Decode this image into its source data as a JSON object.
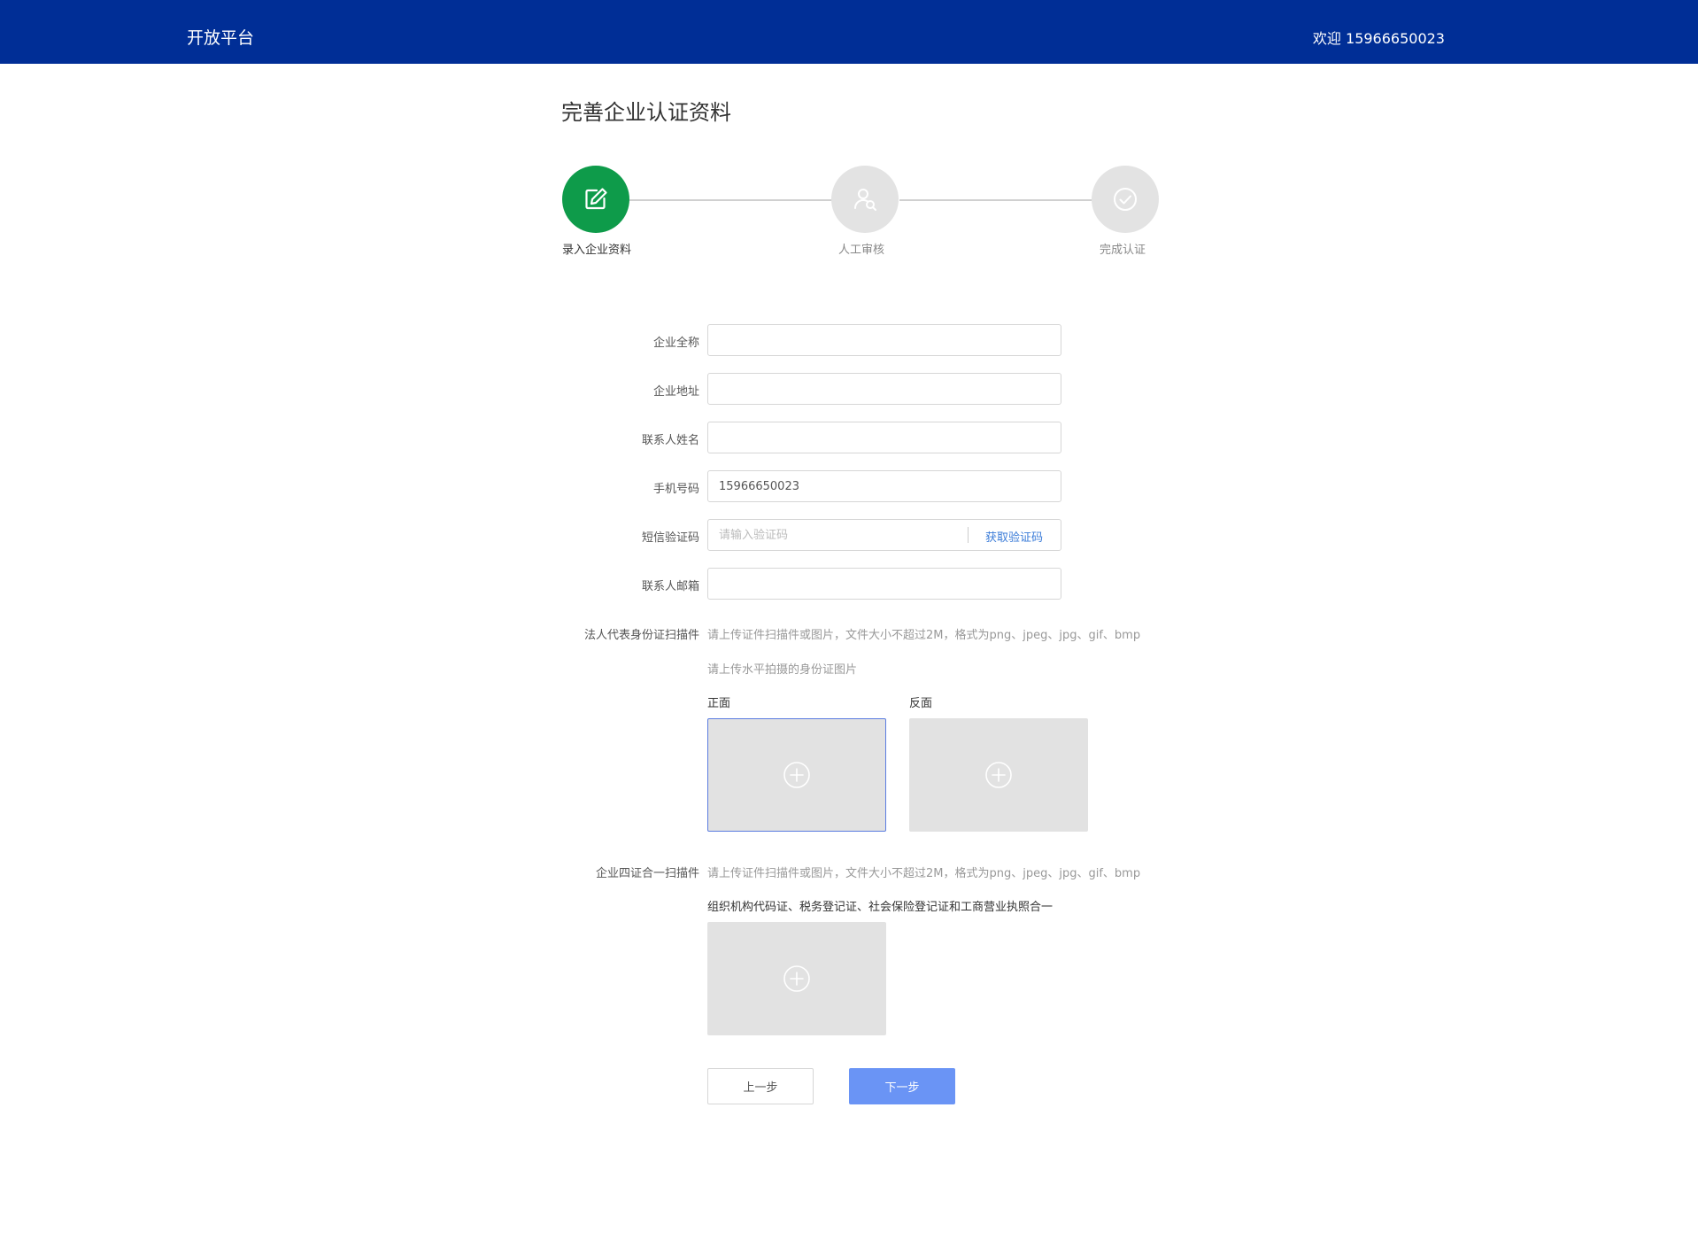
{
  "header": {
    "brand": "开放平台",
    "welcome": "欢迎 15966650023"
  },
  "page_title": "完善企业认证资料",
  "steps": [
    {
      "label": "录入企业资料",
      "icon": "edit-icon",
      "active": true
    },
    {
      "label": "人工审核",
      "icon": "review-icon",
      "active": false
    },
    {
      "label": "完成认证",
      "icon": "check-icon",
      "active": false
    }
  ],
  "form": {
    "company_name_label": "企业全称",
    "company_name_value": "",
    "company_address_label": "企业地址",
    "company_address_value": "",
    "contact_name_label": "联系人姓名",
    "contact_name_value": "",
    "phone_label": "手机号码",
    "phone_value": "15966650023",
    "sms_code_label": "短信验证码",
    "sms_code_placeholder": "请输入验证码",
    "get_code_label": "获取验证码",
    "email_label": "联系人邮箱",
    "email_value": ""
  },
  "id_card": {
    "label": "法人代表身份证扫描件",
    "hint": "请上传证件扫描件或图片，文件大小不超过2M，格式为png、jpeg、jpg、gif、bmp",
    "subhint": "请上传水平拍摄的身份证图片",
    "front_label": "正面",
    "back_label": "反面"
  },
  "license": {
    "label": "企业四证合一扫描件",
    "hint": "请上传证件扫描件或图片，文件大小不超过2M，格式为png、jpeg、jpg、gif、bmp",
    "subhint": "组织机构代码证、税务登记证、社会保险登记证和工商营业执照合一"
  },
  "buttons": {
    "prev": "上一步",
    "next": "下一步"
  },
  "colors": {
    "header_bg": "#002e96",
    "step_active": "#0e9b4a",
    "link": "#3b7cd8",
    "primary_button": "#6a94f5"
  }
}
